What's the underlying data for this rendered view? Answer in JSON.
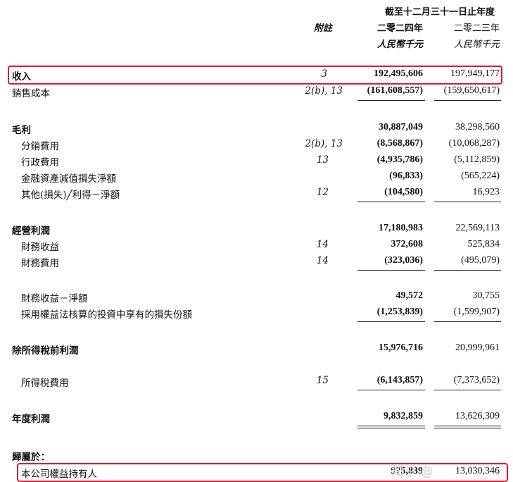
{
  "header": {
    "period": "截至十二月三十一日止年度",
    "note_label": "附註",
    "year_current": "二零二四年",
    "year_prior": "二零二三年",
    "unit_current": "人民幣千元",
    "unit_prior": "人民幣千元"
  },
  "rows": [
    {
      "label": "收入",
      "note": "3",
      "current": "192,495,606",
      "prior": "197,949,177"
    },
    {
      "label": "銷售成本",
      "note": "2(b), 13",
      "current": "(161,608,557)",
      "prior": "(159,650,617)"
    },
    {
      "label": "毛利",
      "note": "",
      "current": "30,887,049",
      "prior": "38,298,560"
    },
    {
      "label": "分銷費用",
      "note": "2(b), 13",
      "current": "(8,568,867)",
      "prior": "(10,068,287)"
    },
    {
      "label": "行政費用",
      "note": "13",
      "current": "(4,935,786)",
      "prior": "(5,112,859)"
    },
    {
      "label": "金融資產減值損失淨額",
      "note": "",
      "current": "(96,833)",
      "prior": "(565,224)"
    },
    {
      "label": "其他(損失)╱利得－淨額",
      "note": "12",
      "current": "(104,580)",
      "prior": "16,923"
    },
    {
      "label": "經營利潤",
      "note": "",
      "current": "17,180,983",
      "prior": "22,569,113"
    },
    {
      "label": "財務收益",
      "note": "14",
      "current": "372,608",
      "prior": "525,834"
    },
    {
      "label": "財務費用",
      "note": "14",
      "current": "(323,036)",
      "prior": "(495,079)"
    },
    {
      "label": "財務收益－淨額",
      "note": "",
      "current": "49,572",
      "prior": "30,755"
    },
    {
      "label": "採用權益法核算的投資中享有的損失份額",
      "note": "",
      "current": "(1,253,839)",
      "prior": "(1,599,907)"
    },
    {
      "label": "除所得稅前利潤",
      "note": "",
      "current": "15,976,716",
      "prior": "20,999,961"
    },
    {
      "label": "所得稅費用",
      "note": "15",
      "current": "(6,143,857)",
      "prior": "(7,373,652)"
    },
    {
      "label": "年度利潤",
      "note": "",
      "current": "9,832,859",
      "prior": "13,626,309"
    },
    {
      "label": "歸屬於：",
      "note": "",
      "current": "",
      "prior": ""
    },
    {
      "label": "本公司權益持有人",
      "note": "",
      "current": "9?5,839",
      "prior": "13,030,346"
    }
  ],
  "watermark": "知乎 @"
}
